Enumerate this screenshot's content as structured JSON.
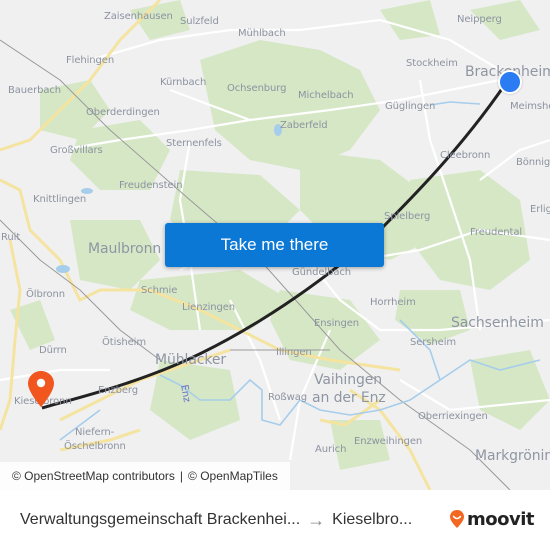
{
  "map": {
    "places": [
      {
        "name": "Zaisenhausen",
        "kind": "village"
      },
      {
        "name": "Sulzfeld",
        "kind": "village"
      },
      {
        "name": "Mühlbach",
        "kind": "village"
      },
      {
        "name": "Neipperg",
        "kind": "village"
      },
      {
        "name": "Flehingen",
        "kind": "village"
      },
      {
        "name": "Stockheim",
        "kind": "village"
      },
      {
        "name": "Brackenheim",
        "kind": "town"
      },
      {
        "name": "Bauerbach",
        "kind": "village"
      },
      {
        "name": "Kürnbach",
        "kind": "village"
      },
      {
        "name": "Ochsenburg",
        "kind": "village"
      },
      {
        "name": "Michelbach",
        "kind": "village"
      },
      {
        "name": "Güglingen",
        "kind": "village"
      },
      {
        "name": "Meimsheim",
        "kind": "village"
      },
      {
        "name": "Oberderdingen",
        "kind": "village"
      },
      {
        "name": "Zaberfeld",
        "kind": "village"
      },
      {
        "name": "Großvillars",
        "kind": "village"
      },
      {
        "name": "Sternenfels",
        "kind": "village"
      },
      {
        "name": "Cleebronn",
        "kind": "village"
      },
      {
        "name": "Bönnigheim",
        "kind": "village"
      },
      {
        "name": "Freudenstein",
        "kind": "village"
      },
      {
        "name": "Knittlingen",
        "kind": "village"
      },
      {
        "name": "Erligheim",
        "kind": "village"
      },
      {
        "name": "Ruit",
        "kind": "village"
      },
      {
        "name": "Spielberg",
        "kind": "village"
      },
      {
        "name": "Maulbronn",
        "kind": "town"
      },
      {
        "name": "Freudental",
        "kind": "village"
      },
      {
        "name": "Gündelbach",
        "kind": "village"
      },
      {
        "name": "Schmie",
        "kind": "village"
      },
      {
        "name": "Ölbronn",
        "kind": "village"
      },
      {
        "name": "Horrheim",
        "kind": "village"
      },
      {
        "name": "Lienzingen",
        "kind": "village"
      },
      {
        "name": "Sachsenheim",
        "kind": "town"
      },
      {
        "name": "Ensingen",
        "kind": "village"
      },
      {
        "name": "Dürrn",
        "kind": "village"
      },
      {
        "name": "Ötisheim",
        "kind": "village"
      },
      {
        "name": "Sersheim",
        "kind": "village"
      },
      {
        "name": "Mühlacker",
        "kind": "town"
      },
      {
        "name": "Illingen",
        "kind": "village"
      },
      {
        "name": "Vaihingen",
        "kind": "town"
      },
      {
        "name": "an der Enz",
        "kind": "town"
      },
      {
        "name": "Roßwag",
        "kind": "village"
      },
      {
        "name": "Enzberg",
        "kind": "village"
      },
      {
        "name": "Kieselbronn",
        "kind": "village"
      },
      {
        "name": "Oberriexingen",
        "kind": "village"
      },
      {
        "name": "Niefern-",
        "kind": "village"
      },
      {
        "name": "Öschelbronn",
        "kind": "village"
      },
      {
        "name": "Enzweihingen",
        "kind": "village"
      },
      {
        "name": "Aurich",
        "kind": "village"
      },
      {
        "name": "Markgröningen",
        "kind": "town"
      },
      {
        "name": "Enz",
        "kind": "river"
      }
    ],
    "take_me_there_label": "Take me there",
    "origin_icon": "origin-location-dot-icon",
    "destination_icon": "destination-pin-icon",
    "colors": {
      "button": "#0b78d6",
      "origin": "#2b7bf3",
      "destination": "#f0561e",
      "route_line": "#222222",
      "forest": "#d3e5c2",
      "road_major": "#fbe9a6",
      "water": "#a8d0ef"
    },
    "attribution": {
      "osm": "© OpenStreetMap contributors",
      "separator": "|",
      "omt": "© OpenMapTiles"
    }
  },
  "footer": {
    "origin": "Verwaltungsgemeinschaft Brackenhei...",
    "arrow": "→",
    "destination": "Kieselbro...",
    "brand": "moovit",
    "brand_color": "#f26722"
  }
}
